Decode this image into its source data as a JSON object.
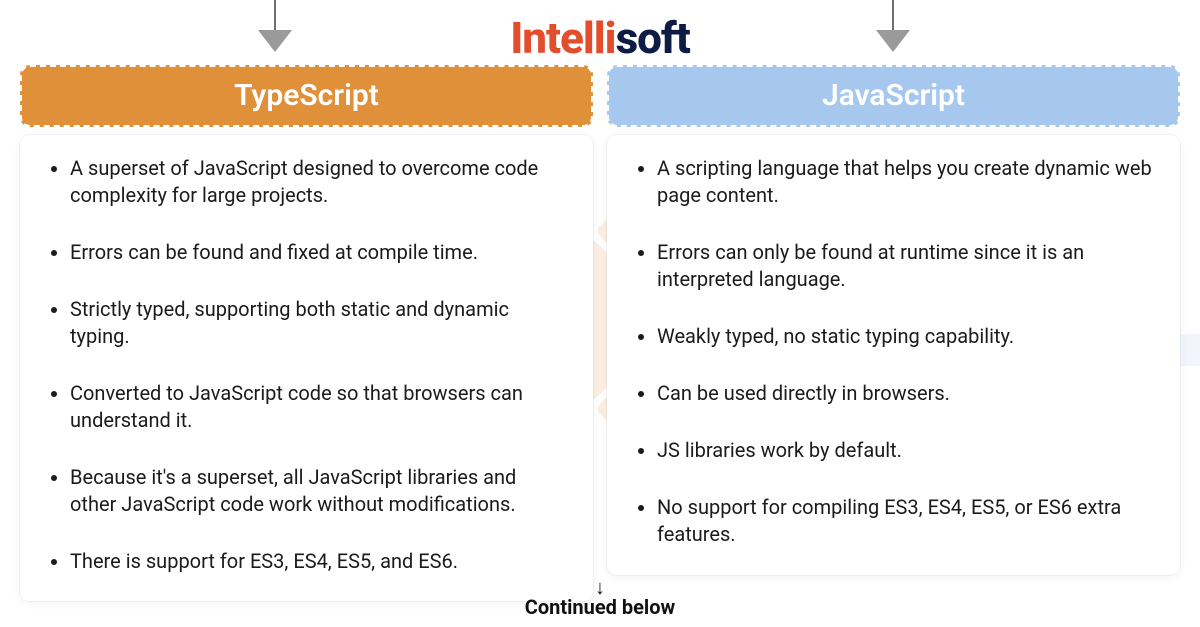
{
  "brand": {
    "part1": "Intelli",
    "part2": "soft"
  },
  "columns": {
    "left": {
      "title": "TypeScript",
      "color": "#e09038",
      "items": [
        "A superset of JavaScript designed to overcome code complexity for large projects.",
        "Errors can be found and fixed at compile time.",
        "Strictly typed, supporting both static and dynamic typing.",
        "Converted to JavaScript code so that browsers can understand it.",
        "Because it's a superset, all JavaScript libraries and other JavaScript code work without modifications.",
        "There is support for ES3, ES4, ES5, and ES6."
      ]
    },
    "right": {
      "title": "JavaScript",
      "color": "#a7c8ee",
      "items": [
        "A scripting language that helps you create dynamic web page content.",
        "Errors can only be found at runtime since it is an interpreted language.",
        "Weakly typed, no static typing capability.",
        "Can be used directly in browsers.",
        "JS libraries work by default.",
        "No support for compiling ES3, ES4, ES5, or ES6 extra features."
      ]
    }
  },
  "footer": {
    "continued_label": "Continued below"
  }
}
